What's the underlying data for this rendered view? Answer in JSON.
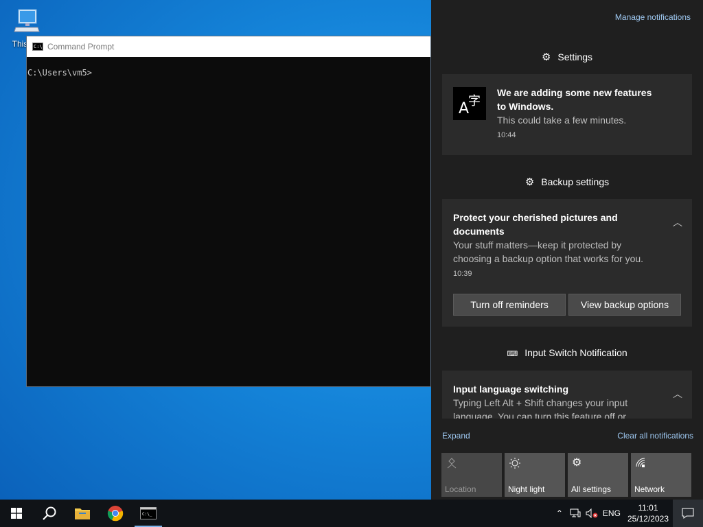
{
  "desktop": {
    "icon_label": "This PC"
  },
  "cmd": {
    "title": "Command Prompt",
    "icon_text": "C:\\",
    "prompt": "C:\\Users\\vm5>"
  },
  "action_center": {
    "manage_link": "Manage notifications",
    "groups": [
      {
        "header": "Settings",
        "icon": "gear-icon",
        "title_line1": "We are adding some new features",
        "title_line2": "to Windows.",
        "desc": "This could take a few minutes.",
        "time": "10:44"
      },
      {
        "header": "Backup settings",
        "icon": "gear-icon",
        "title_line1": "Protect your cherished pictures and",
        "title_line2": "documents",
        "desc_line1": "Your stuff matters—keep it protected by",
        "desc_line2": "choosing a backup option that works for you.",
        "time": "10:39",
        "buttons": [
          "Turn off reminders",
          "View backup options"
        ]
      },
      {
        "header": "Input Switch Notification",
        "icon": "keyboard-icon",
        "title": "Input language switching",
        "desc_line1": "Typing Left Alt + Shift changes your input",
        "desc_line2": "language. You can turn this feature off or"
      }
    ],
    "expand": "Expand",
    "clear_all": "Clear all notifications",
    "tiles": [
      {
        "label": "Location",
        "icon": "location-icon",
        "enabled": false
      },
      {
        "label": "Night light",
        "icon": "brightness-icon",
        "enabled": true
      },
      {
        "label": "All settings",
        "icon": "gear-icon",
        "enabled": true
      },
      {
        "label": "Network",
        "icon": "network-icon",
        "enabled": true
      }
    ]
  },
  "taskbar": {
    "lang": "ENG",
    "time": "11:01",
    "date": "25/12/2023"
  },
  "colors": {
    "accent_link": "#9fc9f2",
    "panel": "#1f1f1f",
    "card": "#2b2b2b"
  }
}
